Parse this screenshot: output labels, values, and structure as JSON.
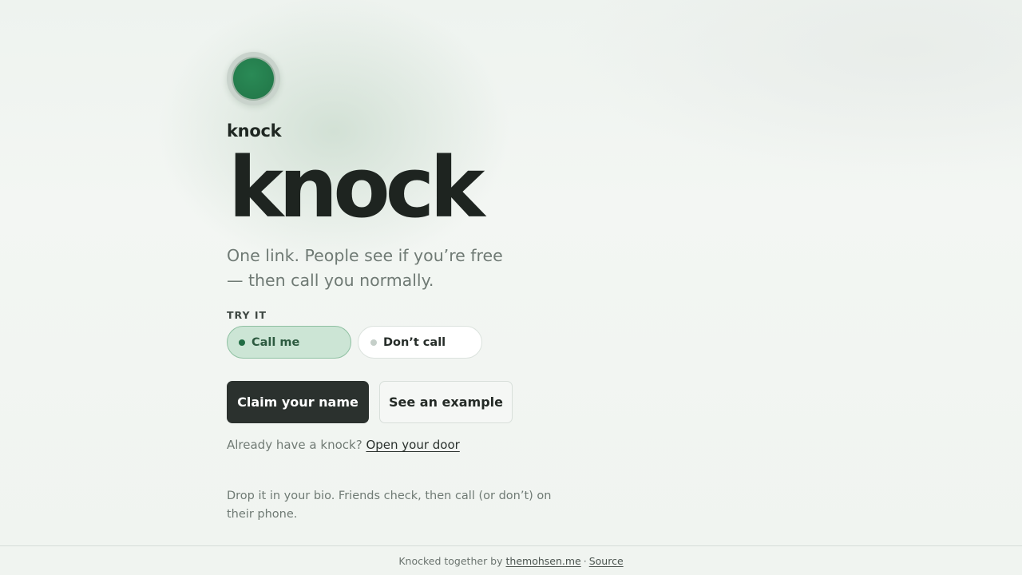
{
  "brand": {
    "name": "knock",
    "status_color": "#217547"
  },
  "hero": {
    "title": "knock"
  },
  "tagline": "One link. People see if you’re free — then call you normally.",
  "try_it": {
    "label": "TRY IT",
    "options": [
      {
        "label": "Call me",
        "selected": true,
        "dot_color": "#216c44"
      },
      {
        "label": "Don’t call",
        "selected": false,
        "dot_color": "#c5cfc9"
      }
    ]
  },
  "actions": {
    "primary_label": "Claim your name",
    "secondary_label": "See an example"
  },
  "signin": {
    "prompt": "Already have a knock?",
    "link_label": "Open your door"
  },
  "description": "Drop it in your bio. Friends check, then call (or don’t) on their phone.",
  "footer": {
    "prefix": "Knocked together by",
    "author_link": "themohsen.me",
    "separator": "·",
    "source_link": "Source"
  }
}
